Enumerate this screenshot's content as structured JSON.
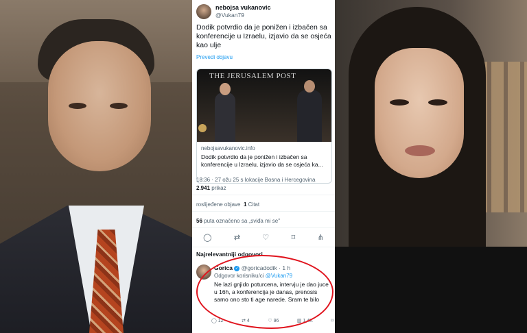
{
  "tweet": {
    "author_name": "nebojsa vukanovic",
    "author_handle": "@Vukan79",
    "text": "Dodik potvrdio da je ponižen i izbačen sa konferencije u Izraelu, izjavio da se osjeća kao ulje",
    "translate_label": "Prevedi objavu",
    "card": {
      "brand": "THE JERUSALEM POST",
      "domain": "nebojsavukanovic.info",
      "title": "Dodik potvrdio da je ponižen i izbačen sa konferencije u Izraelu, izjavio da se osjeća ka..."
    },
    "meta": "18:36 · 27 ožu 25 s lokacije Bosna i Hercegovina",
    "views_count": "2.941",
    "views_label": "prikaz",
    "quotes_prefix": "roslijeđene objave",
    "quotes_count": "1",
    "quotes_label": "Citat",
    "likes_count": "56",
    "likes_label": "puta označeno sa „sviđa mi se\"",
    "actions": [
      "reply-icon",
      "retweet-icon",
      "like-icon",
      "bookmark-icon",
      "share-icon"
    ]
  },
  "replies": {
    "section_label": "Najrelevantniji odgovori",
    "items": [
      {
        "name": "Gorica",
        "handle": "@goricadodik",
        "time": "· 1 h",
        "reply_to_prefix": "Odgovor korisniku/ci",
        "reply_to_handle": "@Vukan79",
        "text": "Ne lazi gnjido poturcena, intervju je dao juce u 16h, a konferencija je danas, prenosis samo ono sto ti age narede. Sram te bilo",
        "stats": {
          "replies": "12",
          "retweets": "4",
          "likes": "96",
          "views": "1,4K"
        }
      }
    ]
  },
  "colors": {
    "highlight_circle": "#e0141e",
    "link": "#1d9bf0"
  }
}
